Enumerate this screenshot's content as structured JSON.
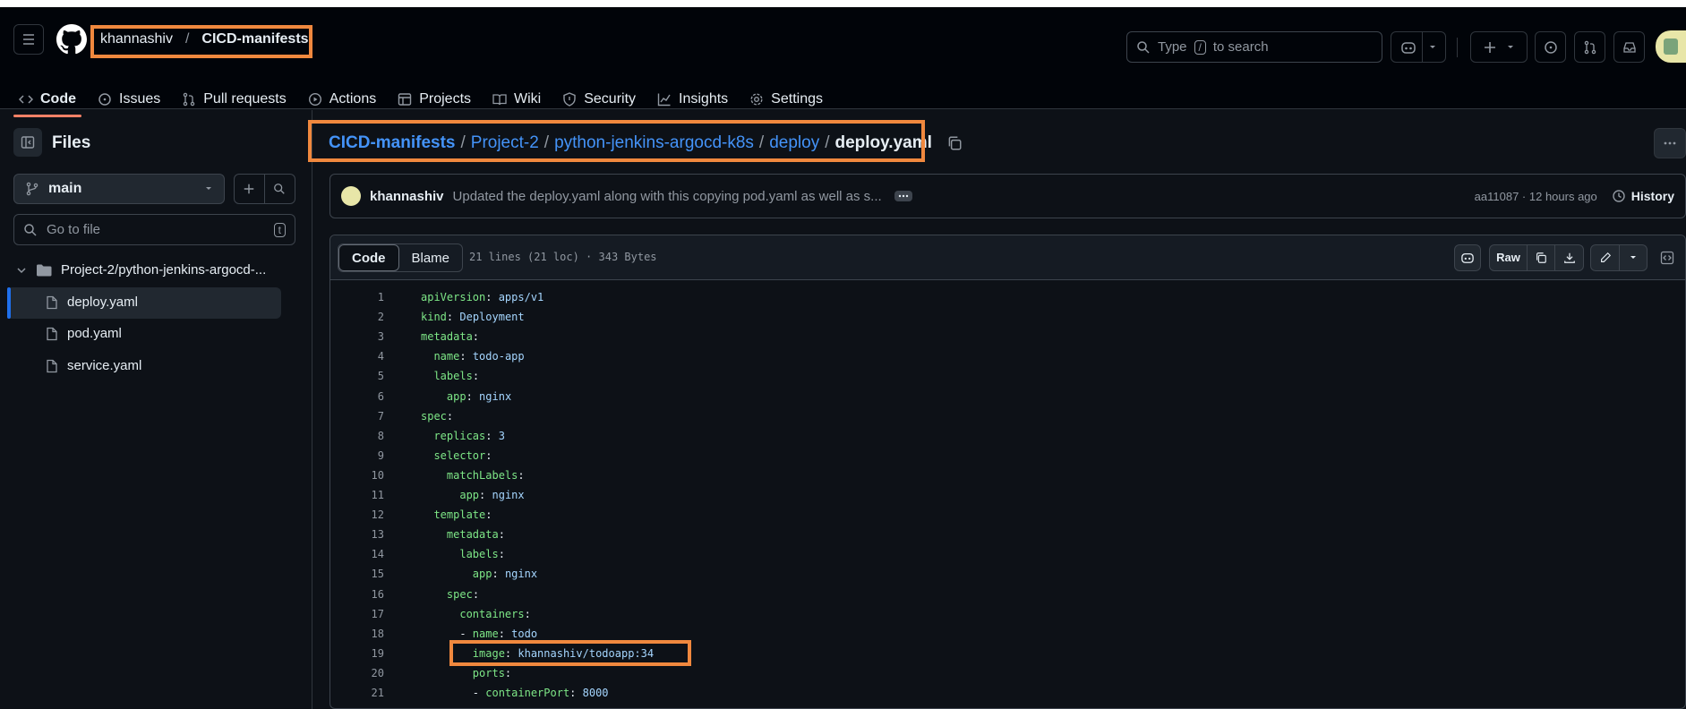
{
  "header": {
    "owner": "khannashiv",
    "separator": "/",
    "repo": "CICD-manifests",
    "search_prefix": "Type",
    "search_key": "/",
    "search_suffix": "to search"
  },
  "tabs": [
    {
      "label": "Code"
    },
    {
      "label": "Issues"
    },
    {
      "label": "Pull requests"
    },
    {
      "label": "Actions"
    },
    {
      "label": "Projects"
    },
    {
      "label": "Wiki"
    },
    {
      "label": "Security"
    },
    {
      "label": "Insights"
    },
    {
      "label": "Settings"
    }
  ],
  "sidebar": {
    "title": "Files",
    "branch": "main",
    "goto_placeholder": "Go to file",
    "goto_key": "t",
    "folder": "Project-2/python-jenkins-argocd-...",
    "files": [
      "deploy.yaml",
      "pod.yaml",
      "service.yaml"
    ]
  },
  "path": {
    "parts": [
      "CICD-manifests",
      "Project-2",
      "python-jenkins-argocd-k8s",
      "deploy"
    ],
    "current": "deploy.yaml",
    "sep": "/"
  },
  "commit": {
    "author": "khannashiv",
    "message": "Updated the deploy.yaml along with this copying pod.yaml as well as s...",
    "hash_time": "aa11087 · 12 hours ago",
    "history": "History"
  },
  "file": {
    "tab_code": "Code",
    "tab_blame": "Blame",
    "meta": "21 lines (21 loc) · 343 Bytes",
    "raw": "Raw"
  },
  "code_lines": [
    {
      "n": "1",
      "indent": "",
      "key": "apiVersion",
      "colon": ":",
      "val": " apps/v1"
    },
    {
      "n": "2",
      "indent": "",
      "key": "kind",
      "colon": ":",
      "val": " Deployment"
    },
    {
      "n": "3",
      "indent": "",
      "key": "metadata",
      "colon": ":",
      "val": ""
    },
    {
      "n": "4",
      "indent": "  ",
      "key": "name",
      "colon": ":",
      "val": " todo-app"
    },
    {
      "n": "5",
      "indent": "  ",
      "key": "labels",
      "colon": ":",
      "val": ""
    },
    {
      "n": "6",
      "indent": "    ",
      "key": "app",
      "colon": ":",
      "val": " nginx"
    },
    {
      "n": "7",
      "indent": "",
      "key": "spec",
      "colon": ":",
      "val": ""
    },
    {
      "n": "8",
      "indent": "  ",
      "key": "replicas",
      "colon": ":",
      "val": " 3"
    },
    {
      "n": "9",
      "indent": "  ",
      "key": "selector",
      "colon": ":",
      "val": ""
    },
    {
      "n": "10",
      "indent": "    ",
      "key": "matchLabels",
      "colon": ":",
      "val": ""
    },
    {
      "n": "11",
      "indent": "      ",
      "key": "app",
      "colon": ":",
      "val": " nginx"
    },
    {
      "n": "12",
      "indent": "  ",
      "key": "template",
      "colon": ":",
      "val": ""
    },
    {
      "n": "13",
      "indent": "    ",
      "key": "metadata",
      "colon": ":",
      "val": ""
    },
    {
      "n": "14",
      "indent": "      ",
      "key": "labels",
      "colon": ":",
      "val": ""
    },
    {
      "n": "15",
      "indent": "        ",
      "key": "app",
      "colon": ":",
      "val": " nginx"
    },
    {
      "n": "16",
      "indent": "    ",
      "key": "spec",
      "colon": ":",
      "val": ""
    },
    {
      "n": "17",
      "indent": "      ",
      "key": "containers",
      "colon": ":",
      "val": ""
    },
    {
      "n": "18",
      "indent": "      - ",
      "key": "name",
      "colon": ":",
      "val": " todo"
    },
    {
      "n": "19",
      "indent": "        ",
      "key": "image",
      "colon": ":",
      "val": " khannashiv/todoapp:34"
    },
    {
      "n": "20",
      "indent": "        ",
      "key": "ports",
      "colon": ":",
      "val": ""
    },
    {
      "n": "21",
      "indent": "        - ",
      "key": "containerPort",
      "colon": ":",
      "val": " 8000"
    }
  ],
  "colors": {
    "accent_link": "#4493f8",
    "highlight_box": "#f0883e",
    "yaml_key": "#7ee787",
    "yaml_value": "#a5d6ff"
  }
}
